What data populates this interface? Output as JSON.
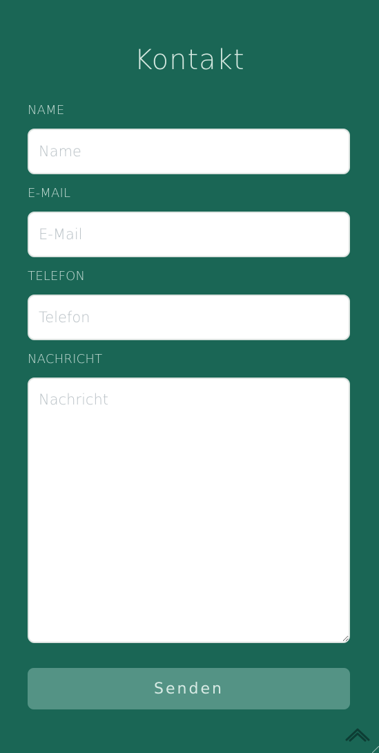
{
  "header": {
    "title": "Kontakt"
  },
  "form": {
    "name": {
      "label": "NAME",
      "placeholder": "Name",
      "value": ""
    },
    "email": {
      "label": "E-MAIL",
      "placeholder": "E-Mail",
      "value": ""
    },
    "phone": {
      "label": "TELEFON",
      "placeholder": "Telefon",
      "value": ""
    },
    "message": {
      "label": "NACHRICHT",
      "placeholder": "Nachricht",
      "value": ""
    },
    "submit_label": "Senden"
  },
  "icons": {
    "scroll_top": "chevron-up-icon"
  },
  "colors": {
    "background": "#1a6655",
    "button": "#549385",
    "label_text": "#c6ddd6",
    "title_text": "#d3e7df",
    "input_background": "#ffffff"
  }
}
